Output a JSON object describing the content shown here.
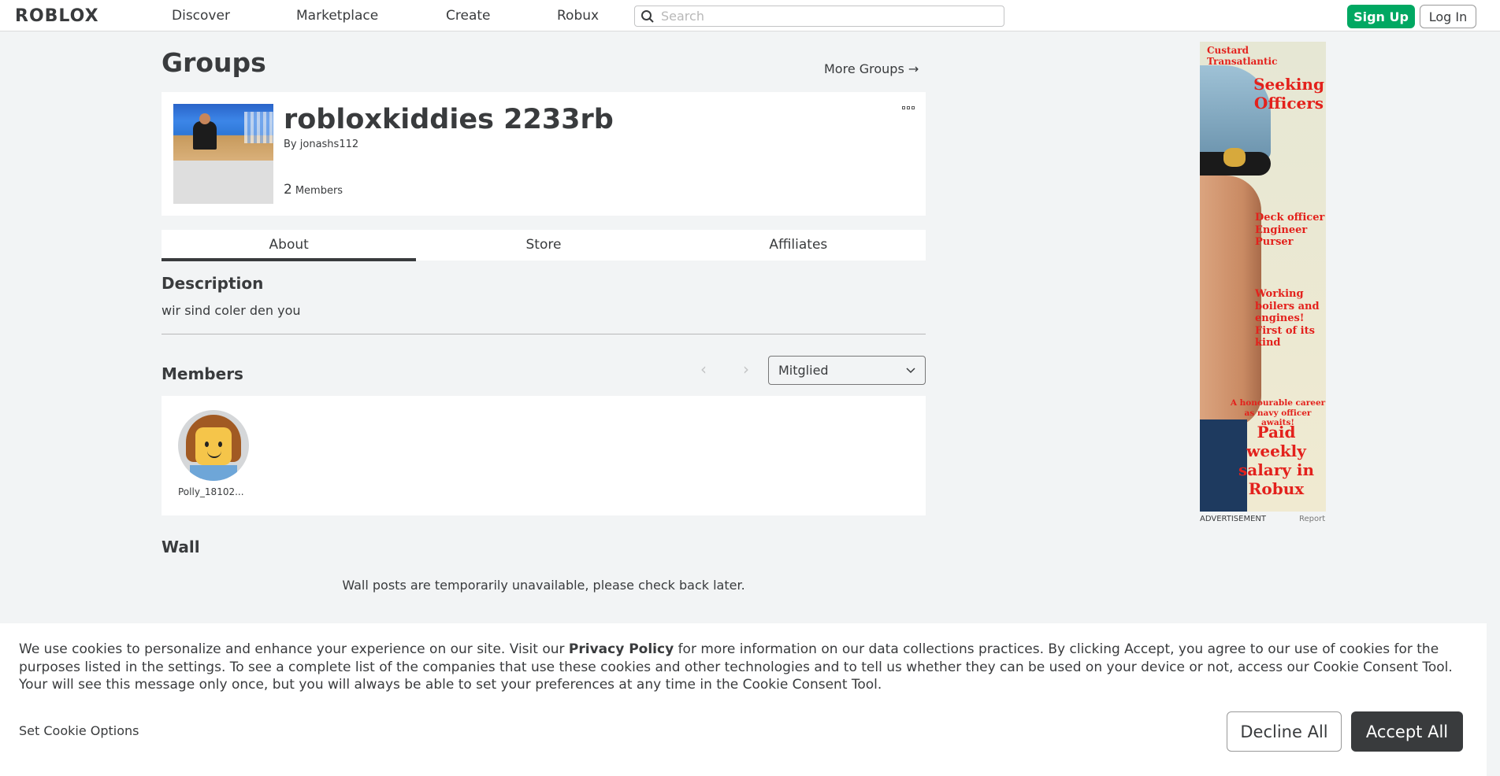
{
  "header": {
    "logo_text": "ROBLOX",
    "nav": [
      "Discover",
      "Marketplace",
      "Create",
      "Robux"
    ],
    "search_placeholder": "Search",
    "signup_label": "Sign Up",
    "login_label": "Log In"
  },
  "page": {
    "title": "Groups",
    "more_groups": "More Groups →"
  },
  "group": {
    "name": "robloxkiddies 2233rb",
    "by_prefix": "By",
    "owner": "jonashs112",
    "member_count": "2",
    "members_label": "Members"
  },
  "tabs": [
    "About",
    "Store",
    "Affiliates"
  ],
  "about": {
    "description_title": "Description",
    "description_text": "wir sind coler den you",
    "members_title": "Members",
    "role_selected": "Mitglied",
    "members": [
      {
        "name": "Polly_18102..."
      }
    ],
    "wall_title": "Wall",
    "wall_message": "Wall posts are temporarily unavailable, please check back later."
  },
  "ad": {
    "brand": "Custard Transatlantic",
    "headline": "Seeking Officers",
    "roles": "Deck officer Engineer Purser",
    "pitch": "Working boilers and engines! First of its kind",
    "career": "A honourable career as navy officer awaits!",
    "salary": "Paid weekly salary in Robux",
    "label": "ADVERTISEMENT",
    "report": "Report"
  },
  "cookie": {
    "text_before": "We use cookies to personalize and enhance your experience on our site. Visit our ",
    "policy_link": "Privacy Policy",
    "text_after": " for more information on our data collections practices. By clicking Accept, you agree to our use of cookies for the purposes listed in the settings. To see a complete list of the companies that use these cookies and other technologies and to tell us whether they can be used on your device or not, access our Cookie Consent Tool. Your will see this message only once, but you will always be able to set your preferences at any time in the Cookie Consent Tool.",
    "options_label": "Set Cookie Options",
    "decline_label": "Decline All",
    "accept_label": "Accept All"
  },
  "colors": {
    "signup_green": "#00a862",
    "accept_dark": "#393b3d",
    "ad_red": "#e3211c"
  }
}
